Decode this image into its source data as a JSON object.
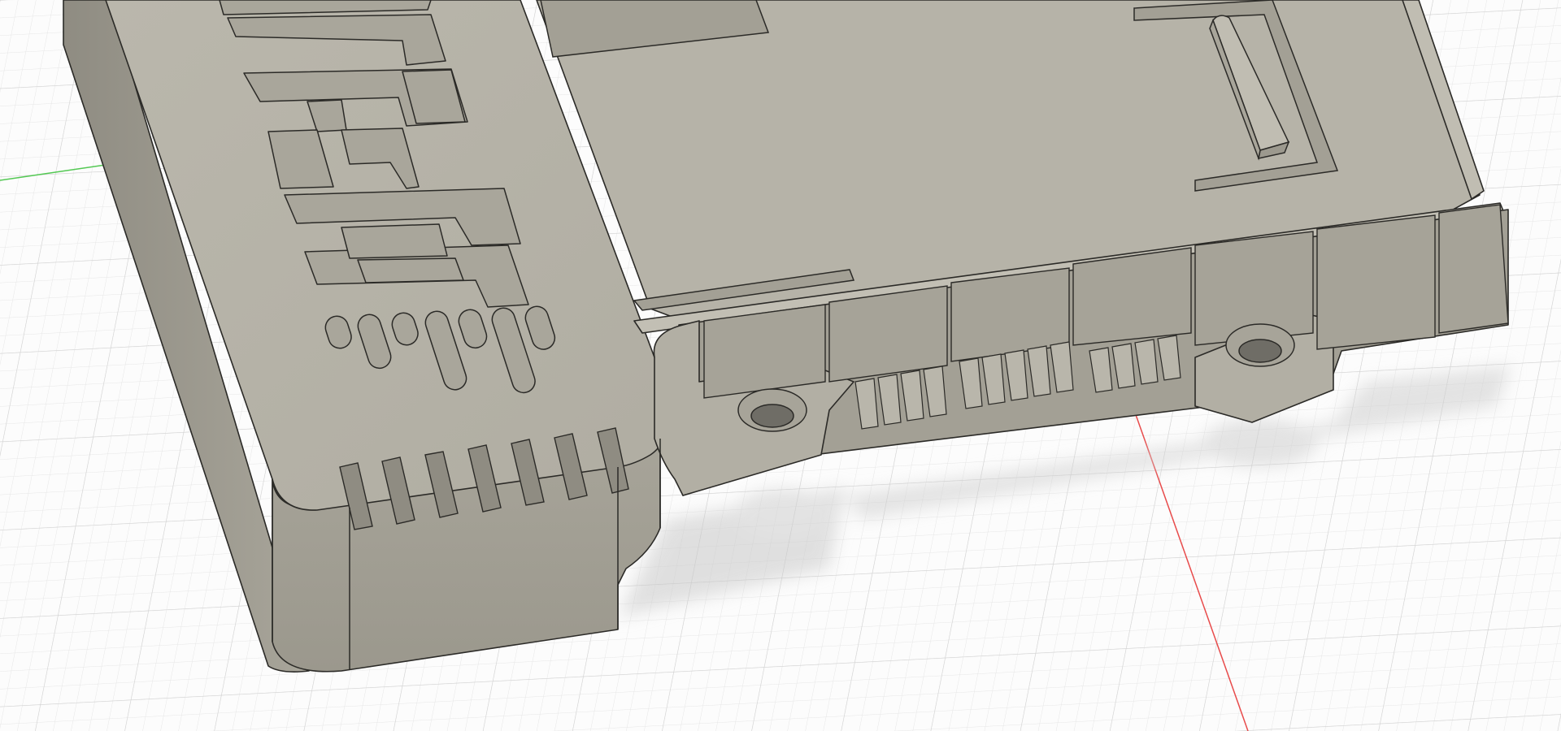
{
  "app": {
    "view": "cad-3d-viewport"
  },
  "scene": {
    "model": "electronics-enclosure-base",
    "label": "",
    "colors": {
      "background": "#fcfcfc",
      "grid_minor": "#e7e7e7",
      "grid_major": "#d6d6d6",
      "axis_red": "#e84b4b",
      "axis_green": "#52c852",
      "body_top": "#b5b2a7",
      "body_side": "#9c998e",
      "body_front": "#a9a69b",
      "floor": "#b9b6ac",
      "edge": "#2b2a27",
      "shadow": "#d4d4d4"
    },
    "features": [
      "engraved-logo",
      "cooling-slots",
      "mounting-tabs",
      "connector-rail",
      "vent-fins"
    ]
  }
}
